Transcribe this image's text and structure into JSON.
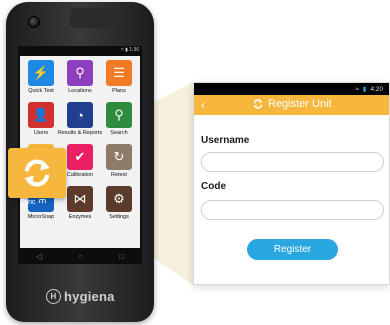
{
  "device": {
    "status_time": "1:36",
    "brand": "hygiena",
    "apps": [
      {
        "label": "Quick Test",
        "color": "#1e88e5",
        "icon": "lightning-icon",
        "glyph": "⚡"
      },
      {
        "label": "Locations",
        "color": "#8e3fbf",
        "icon": "map-pin-icon",
        "glyph": "⚲"
      },
      {
        "label": "Plans",
        "color": "#f07b24",
        "icon": "list-icon",
        "glyph": "☰"
      },
      {
        "label": "Users",
        "color": "#d32f2f",
        "icon": "user-icon",
        "glyph": "👤"
      },
      {
        "label": "Results & Reports",
        "color": "#1f3f8f",
        "icon": "pie-chart-icon",
        "glyph": "◔"
      },
      {
        "label": "Search",
        "color": "#2e8b3e",
        "icon": "search-icon",
        "glyph": "⚲"
      },
      {
        "label": "Sync",
        "color": "#f6b73c",
        "icon": "sync-icon",
        "glyph": "⟳"
      },
      {
        "label": "Calibration",
        "color": "#e91e63",
        "icon": "check-icon",
        "glyph": "✔"
      },
      {
        "label": "Retest",
        "color": "#8d7b68",
        "icon": "retest-icon",
        "glyph": "↻"
      },
      {
        "label": "MicroSnap",
        "color": "#1565c0",
        "icon": "flask-icon",
        "glyph": "⚗"
      },
      {
        "label": "Enzymes",
        "color": "#5d3a2a",
        "icon": "network-icon",
        "glyph": "⋈"
      },
      {
        "label": "Settings",
        "color": "#5a3b2b",
        "icon": "gear-icon",
        "glyph": "⚙"
      }
    ]
  },
  "sync_highlight": {
    "label": "Sync"
  },
  "panel": {
    "status_time": "4:20",
    "title": "Register Unit",
    "username_label": "Username",
    "username_value": "",
    "code_label": "Code",
    "code_value": "",
    "register_label": "Register"
  },
  "colors": {
    "accent": "#f6b73c",
    "button": "#2aa6e0"
  }
}
